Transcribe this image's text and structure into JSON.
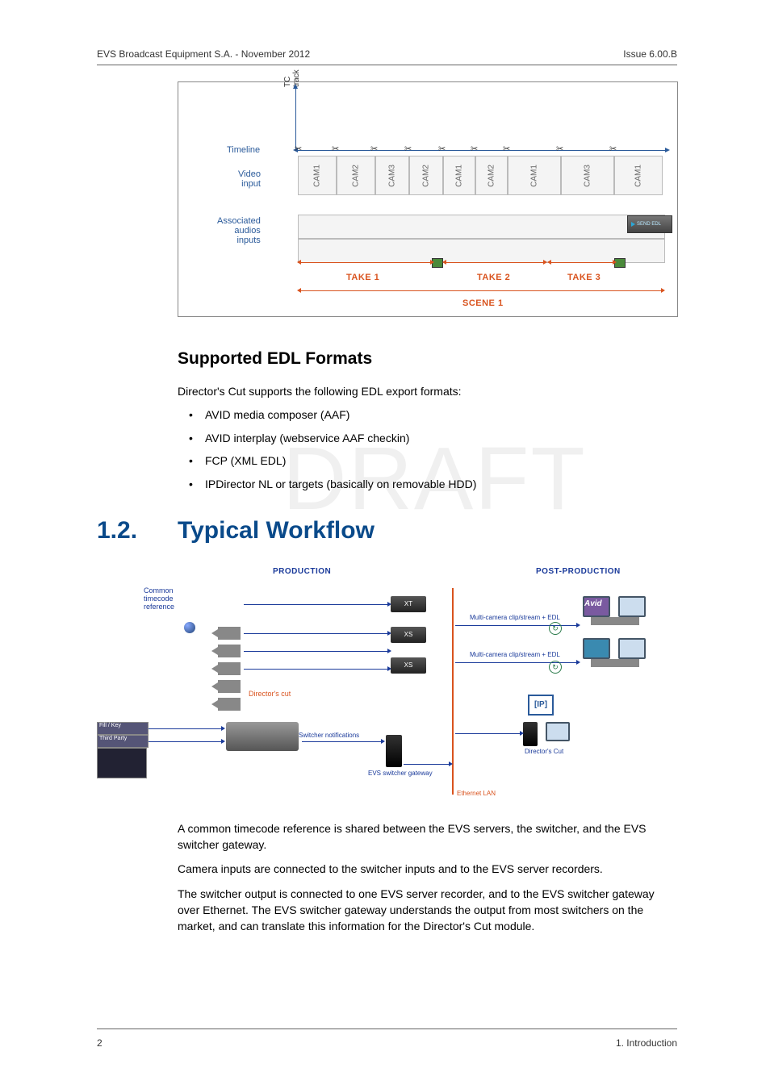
{
  "header": {
    "left": "EVS Broadcast Equipment S.A. - November 2012",
    "right": "Issue 6.00.B"
  },
  "figure1": {
    "labels": {
      "tc_track": "TC track",
      "timeline": "Timeline",
      "video_input": "Video\ninput",
      "assoc_audio": "Associated\naudios\ninputs"
    },
    "segments": [
      "CAM1",
      "CAM2",
      "CAM3",
      "CAM2",
      "CAM1",
      "CAM2",
      "CAM1",
      "CAM3",
      "CAM1"
    ],
    "takes": [
      "TAKE 1",
      "TAKE 2",
      "TAKE 3"
    ],
    "scene": "SCENE 1",
    "send_btn": "SEND EDL"
  },
  "section_supported": {
    "title": "Supported EDL Formats",
    "intro": "Director's Cut supports the following EDL export formats:",
    "bullets": [
      "AVID media composer (AAF)",
      "AVID interplay (webservice AAF checkin)",
      "FCP (XML EDL)",
      "IPDirector NL or targets (basically on removable HDD)"
    ]
  },
  "watermark": "DRAFT",
  "section_workflow": {
    "number": "1.2.",
    "title": "Typical Workflow",
    "fig": {
      "production": "PRODUCTION",
      "post_production": "POST-PRODUCTION",
      "common_tc": "Common\ntimecode\nreference",
      "directors_cut_top": "Director's cut",
      "switcher_notif": "Switcher notifications",
      "evs_gateway": "EVS switcher gateway",
      "ethernet": "Ethernet LAN",
      "multi1": "Multi-camera clip/stream + EDL",
      "multi2": "Multi-camera clip/stream + EDL",
      "directors_cut_ip": "Director's Cut",
      "avid": "Avid",
      "ip": "[IP]",
      "xt": "XT",
      "xs1": "XS",
      "xs2": "XS",
      "third_party": "Third Party",
      "fill_key": "Fill / Key"
    },
    "paragraphs": [
      "A common timecode reference is shared between the EVS servers, the switcher, and the EVS switcher gateway.",
      "Camera inputs are connected to the switcher inputs and to the EVS server recorders.",
      "The switcher output is connected to one EVS server recorder, and to the EVS switcher gateway over Ethernet. The EVS switcher gateway understands the output from most switchers on the market, and can translate this information for the Director's Cut module."
    ]
  },
  "footer": {
    "page": "2",
    "section": "1. Introduction"
  }
}
